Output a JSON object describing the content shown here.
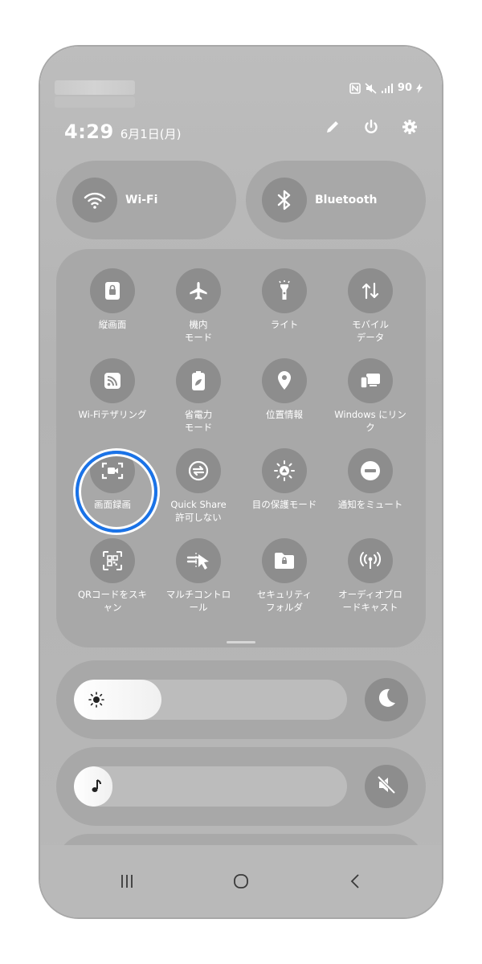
{
  "status_bar": {
    "battery": "90"
  },
  "header": {
    "time": "4:29",
    "date": "6月1日(月)"
  },
  "toggles": {
    "wifi": "Wi-Fi",
    "bluetooth": "Bluetooth"
  },
  "tiles": [
    {
      "line1": "縦画面",
      "line2": ""
    },
    {
      "line1": "機内",
      "line2": "モード"
    },
    {
      "line1": "ライト",
      "line2": ""
    },
    {
      "line1": "モバイル",
      "line2": "データ"
    },
    {
      "line1": "Wi-Fiテザリング",
      "line2": ""
    },
    {
      "line1": "省電力",
      "line2": "モード"
    },
    {
      "line1": "位置情報",
      "line2": ""
    },
    {
      "line1": "Windows にリン",
      "line2": "ク"
    },
    {
      "line1": "画面録画",
      "line2": ""
    },
    {
      "line1": "Quick Share",
      "line2": "許可しない"
    },
    {
      "line1": "目の保護モード",
      "line2": ""
    },
    {
      "line1": "通知をミュート",
      "line2": ""
    },
    {
      "line1": "QRコードをスキ",
      "line2": "ャン"
    },
    {
      "line1": "マルチコントロ",
      "line2": "ール"
    },
    {
      "line1": "セキュリティ",
      "line2": "フォルダ"
    },
    {
      "line1": "オーディオブロ",
      "line2": "ードキャスト"
    }
  ],
  "brightness": {
    "level": 0.32
  },
  "volume": {
    "level": 0.0
  },
  "icons": {
    "status": [
      "nfc-icon",
      "mute-icon",
      "signal-icon",
      "battery-charging-icon"
    ],
    "header": [
      "edit-icon",
      "power-icon",
      "settings-icon"
    ],
    "nav": [
      "recent-apps-icon",
      "home-icon",
      "back-icon"
    ]
  },
  "colors": {
    "highlight_ring": "#1a73e8"
  }
}
